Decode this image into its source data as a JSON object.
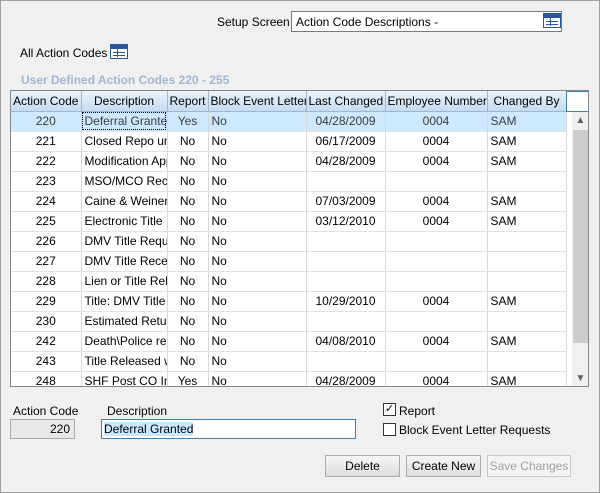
{
  "setup": {
    "label": "Setup Screen",
    "value": "Action Code Descriptions -"
  },
  "all_codes_label": "All Action Codes",
  "section_title": "User Defined Action Codes 220 - 255",
  "table": {
    "columns": [
      "Action Code",
      "Description",
      "Report",
      "Block Event Letter",
      "Last Changed",
      "Employee Number",
      "Changed By"
    ],
    "rows": [
      {
        "code": "220",
        "desc": "Deferral Granted",
        "report": "Yes",
        "block": "No",
        "changed": "04/28/2009",
        "emp": "0004",
        "by": "SAM"
      },
      {
        "code": "221",
        "desc": "Closed Repo unit",
        "report": "No",
        "block": "No",
        "changed": "06/17/2009",
        "emp": "0004",
        "by": "SAM"
      },
      {
        "code": "222",
        "desc": "Modification Approved",
        "report": "No",
        "block": "No",
        "changed": "04/28/2009",
        "emp": "0004",
        "by": "SAM"
      },
      {
        "code": "223",
        "desc": "MSO/MCO Received",
        "report": "No",
        "block": "No",
        "changed": "",
        "emp": "",
        "by": ""
      },
      {
        "code": "224",
        "desc": "Caine & Weiner",
        "report": "No",
        "block": "No",
        "changed": "07/03/2009",
        "emp": "0004",
        "by": "SAM"
      },
      {
        "code": "225",
        "desc": "Electronic Title",
        "report": "No",
        "block": "No",
        "changed": "03/12/2010",
        "emp": "0004",
        "by": "SAM"
      },
      {
        "code": "226",
        "desc": "DMV Title Requested",
        "report": "No",
        "block": "No",
        "changed": "",
        "emp": "",
        "by": ""
      },
      {
        "code": "227",
        "desc": "DMV Title Received",
        "report": "No",
        "block": "No",
        "changed": "",
        "emp": "",
        "by": ""
      },
      {
        "code": "228",
        "desc": "Lien or Title Released",
        "report": "No",
        "block": "No",
        "changed": "",
        "emp": "",
        "by": ""
      },
      {
        "code": "229",
        "desc": "Title: DMV Title",
        "report": "No",
        "block": "No",
        "changed": "10/29/2010",
        "emp": "0004",
        "by": "SAM"
      },
      {
        "code": "230",
        "desc": "Estimated Return",
        "report": "No",
        "block": "No",
        "changed": "",
        "emp": "",
        "by": ""
      },
      {
        "code": "242",
        "desc": "Death\\Police report",
        "report": "No",
        "block": "No",
        "changed": "04/08/2010",
        "emp": "0004",
        "by": "SAM"
      },
      {
        "code": "243",
        "desc": "Title Released w",
        "report": "No",
        "block": "No",
        "changed": "",
        "emp": "",
        "by": ""
      },
      {
        "code": "248",
        "desc": "SHF Post CO Im",
        "report": "Yes",
        "block": "No",
        "changed": "04/28/2009",
        "emp": "0004",
        "by": "SAM"
      }
    ]
  },
  "form": {
    "code_label": "Action Code",
    "code_value": "220",
    "desc_label": "Description",
    "desc_value": "Deferral Granted",
    "report_label": "Report",
    "report_checked": true,
    "block_label": "Block Event Letter Requests",
    "block_checked": false
  },
  "buttons": {
    "delete": "Delete",
    "create": "Create New",
    "save": "Save Changes"
  },
  "colors": {
    "selection": "#cde8ff",
    "section_title": "#9eb6d6",
    "header_gradient_top": "#eaf3fb",
    "header_gradient_bottom": "#c4dcf1"
  }
}
